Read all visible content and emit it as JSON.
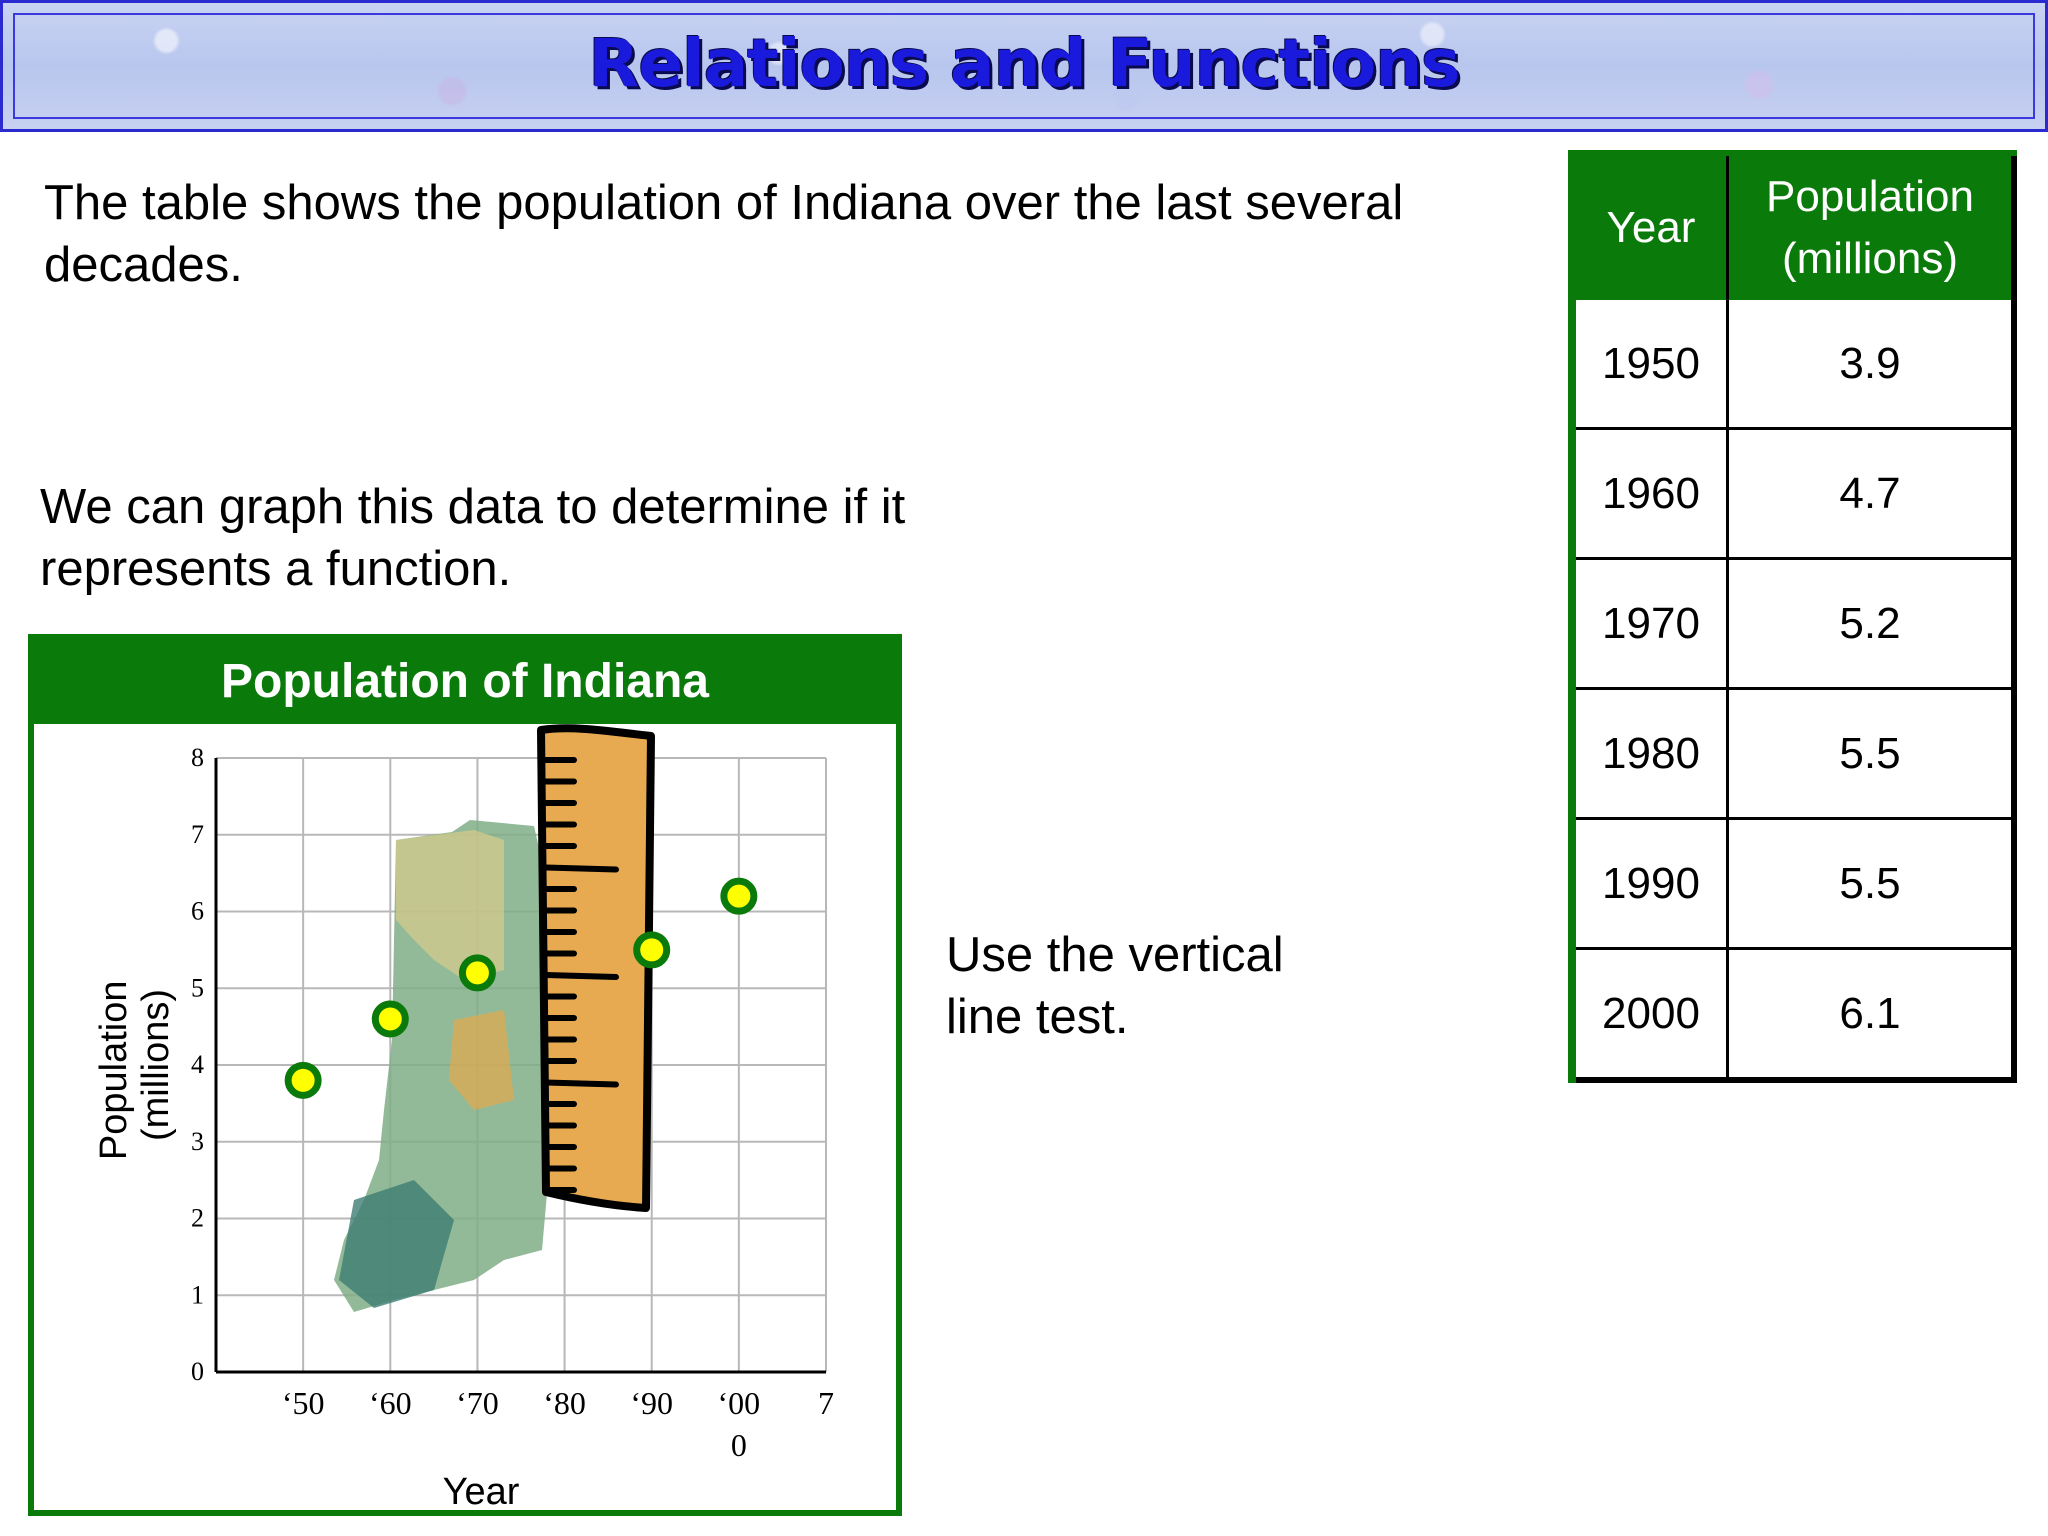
{
  "slide": {
    "title": "Relations and Functions",
    "intro": "The table shows the population of Indiana over the last several decades.",
    "graph_text": "We can graph this data to determine if it represents a function.",
    "vertical_line_text": "Use the vertical line test."
  },
  "table": {
    "headers": {
      "year": "Year",
      "population_line1": "Population",
      "population_line2": "(millions)"
    },
    "rows": [
      {
        "year": "1950",
        "population": "3.9"
      },
      {
        "year": "1960",
        "population": "4.7"
      },
      {
        "year": "1970",
        "population": "5.2"
      },
      {
        "year": "1980",
        "population": "5.5"
      },
      {
        "year": "1990",
        "population": "5.5"
      },
      {
        "year": "2000",
        "population": "6.1"
      }
    ]
  },
  "chart_data": {
    "type": "scatter",
    "title": "Population of Indiana",
    "xlabel": "Year",
    "ylabel": "Population (millions)",
    "ylabel_lines": [
      "Population",
      "(millions)"
    ],
    "x": [
      1950,
      1960,
      1970,
      1980,
      1990,
      2000
    ],
    "y": [
      3.9,
      4.7,
      5.2,
      5.5,
      5.5,
      6.1
    ],
    "visible_points_y": [
      3.8,
      4.6,
      5.2,
      null,
      5.5,
      6.2
    ],
    "x_ticks": [
      {
        "value": 1950,
        "label": "‘50"
      },
      {
        "value": 1960,
        "label": "‘60"
      },
      {
        "value": 1970,
        "label": "‘70"
      },
      {
        "value": 1980,
        "label": "‘80"
      },
      {
        "value": 1990,
        "label": "‘90"
      },
      {
        "value": 2000,
        "label": "‘00",
        "sublabel": "0"
      },
      {
        "value": 2010,
        "label": "7"
      }
    ],
    "y_ticks": [
      0,
      1,
      2,
      3,
      4,
      5,
      6,
      7,
      8
    ],
    "xlim": [
      1940,
      2010
    ],
    "ylim": [
      0,
      8
    ],
    "grid": true,
    "marker_fill": "#ffff00",
    "marker_edge": "#0a7a0a",
    "accent": "#0a7a0a"
  }
}
